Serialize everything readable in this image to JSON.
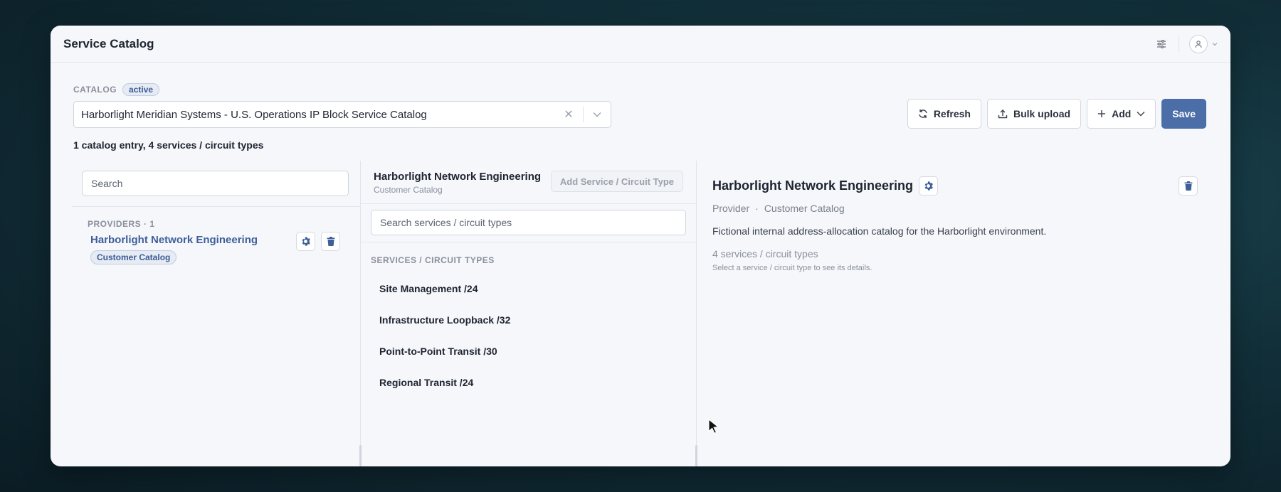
{
  "app": {
    "title": "Service Catalog"
  },
  "catalog": {
    "label": "CATALOG",
    "status": "active",
    "selected": "Harborlight Meridian Systems - U.S. Operations IP Block Service Catalog",
    "summary": "1 catalog entry, 4 services / circuit types"
  },
  "toolbar": {
    "refresh_label": "Refresh",
    "bulk_upload_label": "Bulk upload",
    "add_label": "Add",
    "save_label": "Save"
  },
  "providers_panel": {
    "search_placeholder": "Search",
    "section_label": "PROVIDERS · 1",
    "items": [
      {
        "name": "Harborlight Network Engineering",
        "tag": "Customer Catalog"
      }
    ]
  },
  "services_panel": {
    "provider_name": "Harborlight Network Engineering",
    "provider_sub": "Customer Catalog",
    "add_button_label": "Add Service / Circuit Type",
    "search_placeholder": "Search services / circuit types",
    "section_label": "SERVICES / CIRCUIT TYPES",
    "items": [
      {
        "name": "Site Management /24"
      },
      {
        "name": "Infrastructure Loopback /32"
      },
      {
        "name": "Point-to-Point Transit /30"
      },
      {
        "name": "Regional Transit /24"
      }
    ]
  },
  "detail_panel": {
    "title": "Harborlight Network Engineering",
    "meta_type": "Provider",
    "meta_sep": "·",
    "meta_catalog": "Customer Catalog",
    "description": "Fictional internal address-allocation catalog for the Harborlight environment.",
    "count": "4 services / circuit types",
    "hint": "Select a service / circuit type to see its details."
  },
  "colors": {
    "accent": "#4c6ea8",
    "link": "#3e5f9a",
    "pill_bg": "#e6ebf4"
  }
}
